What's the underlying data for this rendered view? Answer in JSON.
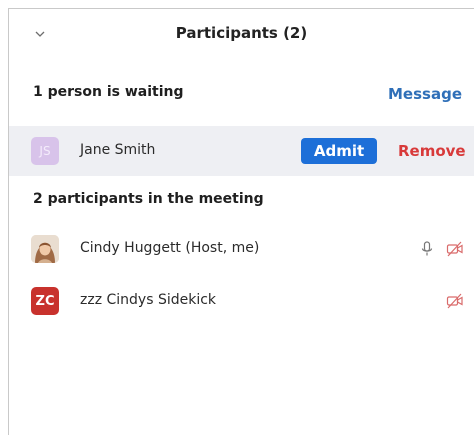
{
  "header": {
    "title": "Participants (2)",
    "collapse_icon": "chevron-down-icon"
  },
  "waiting": {
    "heading": "1 person is waiting",
    "message_label": "Message",
    "people": [
      {
        "initials": "JS",
        "name": "Jane Smith",
        "avatar_color": "#d8c3ea",
        "admit_label": "Admit",
        "remove_label": "Remove"
      }
    ]
  },
  "meeting": {
    "heading": "2 participants in the meeting",
    "participants": [
      {
        "name": "Cindy Huggett (Host, me)",
        "avatar": "photo",
        "icons": [
          "microphone-icon",
          "video-off-icon"
        ]
      },
      {
        "initials": "ZC",
        "name": "zzz Cindys Sidekick",
        "avatar_color": "#c8322d",
        "icons": [
          "video-off-icon"
        ]
      }
    ]
  },
  "colors": {
    "accent_blue": "#1d6fd8",
    "link_blue": "#2f6fb8",
    "remove_red": "#d83a3a",
    "muted_red": "#d96b6b",
    "waiting_row_bg": "#eeeff3"
  }
}
